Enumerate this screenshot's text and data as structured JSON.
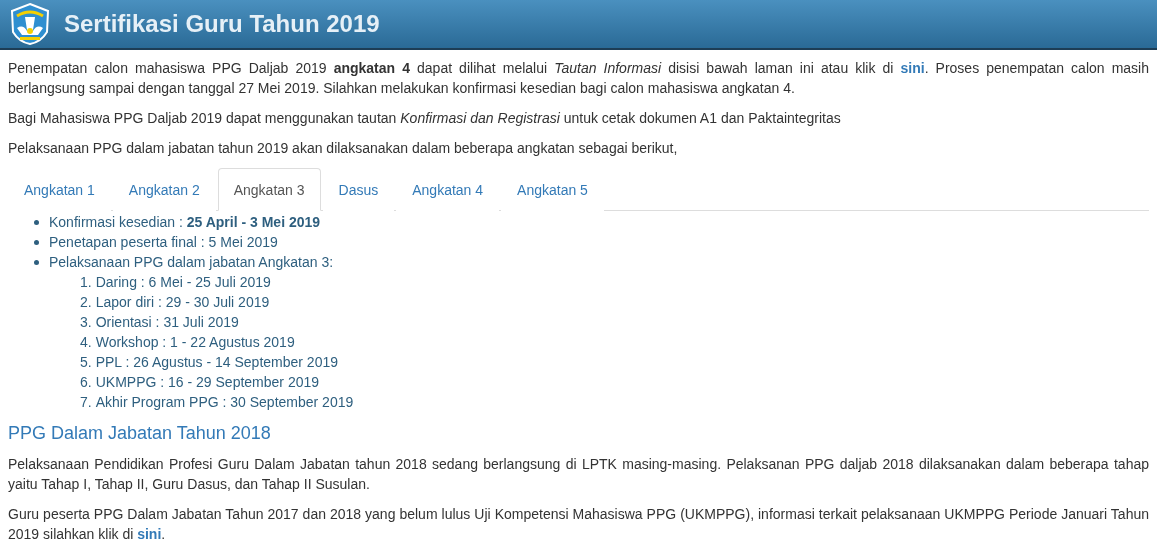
{
  "header": {
    "title": "Sertifikasi Guru Tahun 2019"
  },
  "intro": [
    [
      {
        "kind": "text",
        "text": "Penempatan calon mahasiswa PPG Daljab 2019 **angkatan 4** dapat dilihat melalui *Tautan Informasi* disisi bawah laman ini atau klik di "
      },
      {
        "kind": "link",
        "text": "sini"
      },
      {
        "kind": "text",
        "text": ". Proses penempatan calon masih berlangsung sampai dengan tanggal 27 Mei 2019. Silahkan melakukan konfirmasi kesedian bagi calon mahasiswa angkatan 4."
      }
    ],
    [
      {
        "kind": "text",
        "text": "Bagi Mahasiswa PPG Daljab 2019 dapat menggunakan tautan *Konfirmasi dan Registrasi* untuk cetak dokumen A1 dan Paktaintegritas"
      }
    ],
    [
      {
        "kind": "text",
        "text": "Pelaksanaan PPG dalam jabatan tahun 2019 akan dilaksanakan dalam beberapa angkatan sebagai berikut,"
      }
    ]
  ],
  "tabs": [
    {
      "label": "Angkatan 1",
      "selected": false
    },
    {
      "label": "Angkatan 2",
      "selected": false
    },
    {
      "label": "Angkatan 3",
      "selected": true
    },
    {
      "label": "Dasus",
      "selected": false
    },
    {
      "label": "Angkatan 4",
      "selected": false
    },
    {
      "label": "Angkatan 5",
      "selected": false
    }
  ],
  "tab_content": [
    {
      "text": "Konfirmasi kesedian : **25 April - 3 Mei 2019**"
    },
    {
      "text": "Penetapan peserta final : 5 Mei 2019"
    },
    {
      "text": "Pelaksanaan PPG dalam jabatan Angkatan 3:",
      "children": [
        {
          "number": "1.",
          "text": "Daring : 6 Mei - 25 Juli 2019"
        },
        {
          "number": "2.",
          "text": "Lapor diri : 29 - 30 Juli 2019"
        },
        {
          "number": "3.",
          "text": "Orientasi : 31 Juli 2019"
        },
        {
          "number": "4.",
          "text": "Workshop : 1 - 22 Agustus 2019"
        },
        {
          "number": "5.",
          "text": "PPL : 26 Agustus - 14 September 2019"
        },
        {
          "number": "6.",
          "text": "UKMPPG : 16 - 29 September 2019"
        },
        {
          "number": "7.",
          "text": "Akhir Program PPG : 30 September 2019"
        }
      ]
    }
  ],
  "section_2018": {
    "heading": "PPG Dalam Jabatan Tahun 2018",
    "paragraphs": [
      [
        {
          "kind": "text",
          "text": "Pelaksanaan Pendidikan Profesi Guru Dalam Jabatan tahun 2018 sedang berlangsung di LPTK masing-masing. Pelaksanan PPG daljab 2018 dilaksanakan dalam beberapa tahap yaitu Tahap I, Tahap II, Guru Dasus, dan Tahap II Susulan."
        }
      ],
      [
        {
          "kind": "text",
          "text": "Guru peserta PPG Dalam Jabatan Tahun 2017 dan 2018 yang belum lulus Uji Kompetensi Mahasiswa PPG (UKMPPG), informasi terkait pelaksanaan UKMPPG Periode Januari Tahun 2019 silahkan klik di "
        },
        {
          "kind": "link",
          "text": "sini"
        },
        {
          "kind": "text",
          "text": "."
        }
      ]
    ]
  }
}
